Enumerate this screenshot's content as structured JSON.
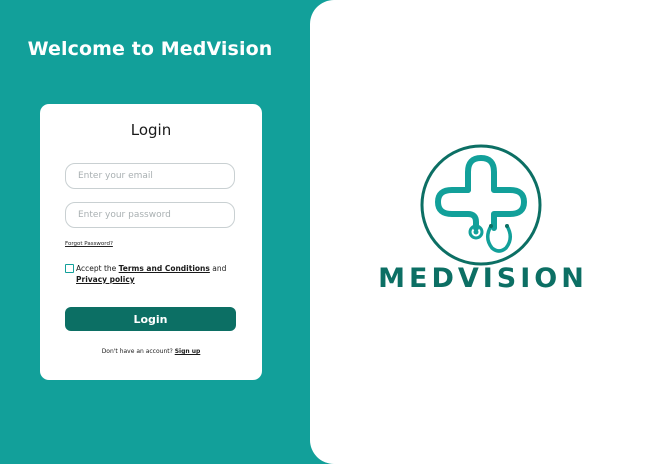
{
  "left_panel": {
    "welcome_title": "Welcome to MedVision"
  },
  "login_card": {
    "title": "Login",
    "email_placeholder": "Enter your email",
    "password_placeholder": "Enter your password",
    "forgot_password": "Forgot Password?",
    "terms": {
      "prefix": "Accept the ",
      "terms_link": "Terms and Conditions",
      "and_text": " and",
      "privacy_link": "Privacy policy"
    },
    "login_button": "Login",
    "signup_prompt": "Don't have  an account? ",
    "signup_link": "Sign up"
  },
  "brand": {
    "name": "MEDVISION",
    "logo_icon": "stethoscope-cross-logo"
  },
  "colors": {
    "teal": "#12a09a",
    "dark_teal": "#0c6f64",
    "white": "#ffffff"
  }
}
